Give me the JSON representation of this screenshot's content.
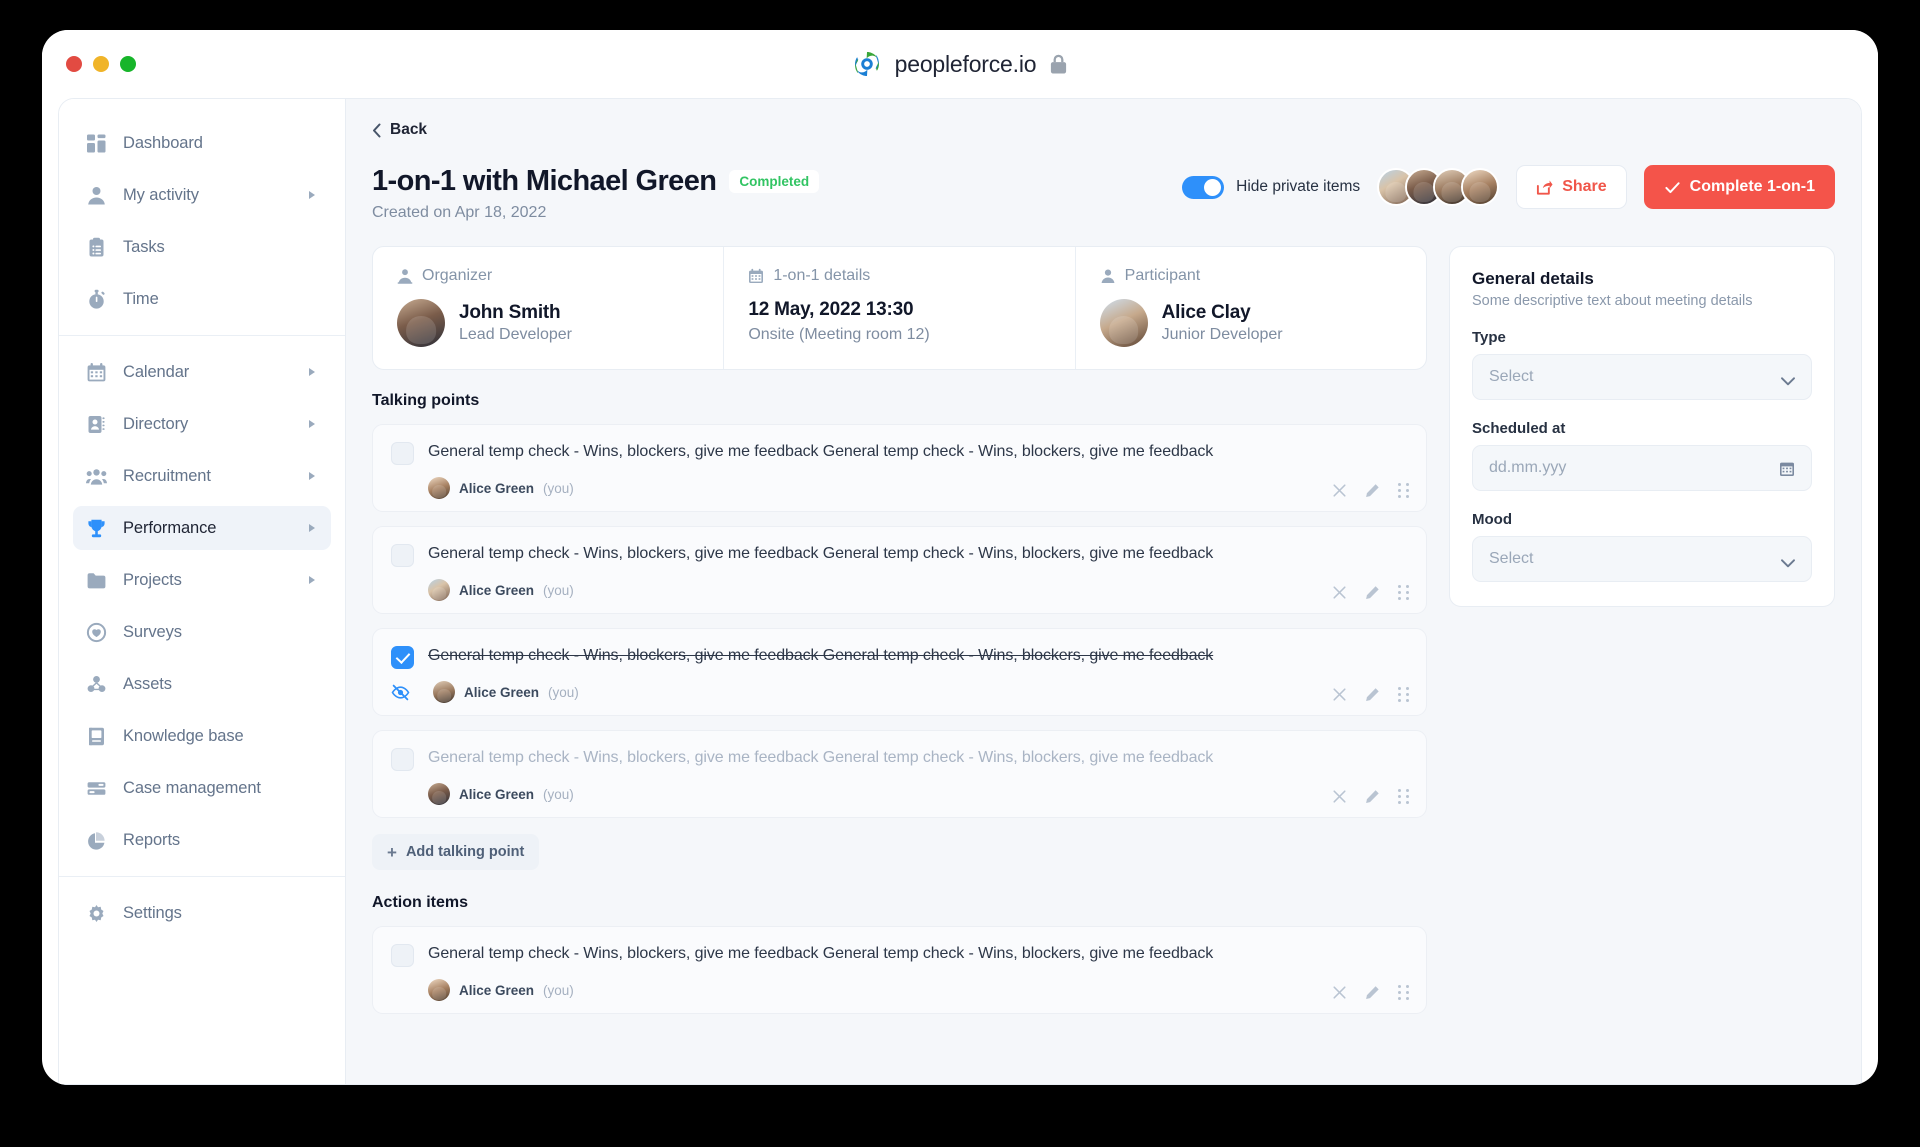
{
  "browser": {
    "url_text": "peopleforce.io",
    "lock_icon": "lock-icon",
    "logo_icon": "peopleforce-logo-icon"
  },
  "sidebar": {
    "groups": [
      {
        "items": [
          {
            "label": "Dashboard",
            "icon": "dashboard-icon",
            "has_arrow": false,
            "active": false
          },
          {
            "label": "My activity",
            "icon": "user-icon",
            "has_arrow": true,
            "active": false
          },
          {
            "label": "Tasks",
            "icon": "clipboard-icon",
            "has_arrow": false,
            "active": false
          },
          {
            "label": "Time",
            "icon": "stopwatch-icon",
            "has_arrow": false,
            "active": false
          }
        ]
      },
      {
        "items": [
          {
            "label": "Calendar",
            "icon": "calendar-icon",
            "has_arrow": true,
            "active": false
          },
          {
            "label": "Directory",
            "icon": "contact-card-icon",
            "has_arrow": true,
            "active": false
          },
          {
            "label": "Recruitment",
            "icon": "people-group-icon",
            "has_arrow": true,
            "active": false
          },
          {
            "label": "Performance",
            "icon": "trophy-icon",
            "has_arrow": true,
            "active": true
          },
          {
            "label": "Projects",
            "icon": "folder-icon",
            "has_arrow": true,
            "active": false
          },
          {
            "label": "Surveys",
            "icon": "heart-shield-icon",
            "has_arrow": false,
            "active": false
          },
          {
            "label": "Assets",
            "icon": "assets-icon",
            "has_arrow": false,
            "active": false
          },
          {
            "label": "Knowledge base",
            "icon": "book-icon",
            "has_arrow": false,
            "active": false
          },
          {
            "label": "Case management",
            "icon": "cases-icon",
            "has_arrow": false,
            "active": false
          },
          {
            "label": "Reports",
            "icon": "pie-chart-icon",
            "has_arrow": false,
            "active": false
          }
        ]
      },
      {
        "items": [
          {
            "label": "Settings",
            "icon": "gear-icon",
            "has_arrow": false,
            "active": false
          }
        ]
      }
    ]
  },
  "header": {
    "back_label": "Back",
    "title": "1-on-1 with Michael Green",
    "status_badge": "Completed",
    "subtitle": "Created on Apr 18, 2022",
    "toggle_label": "Hide private items",
    "toggle_on": true,
    "share_label": "Share",
    "complete_label": "Complete 1-on-1"
  },
  "info_cards": {
    "organizer": {
      "label": "Organizer",
      "icon": "organizer-icon",
      "name": "John Smith",
      "role": "Lead Developer"
    },
    "details": {
      "label": "1-on-1 details",
      "icon": "calendar-icon",
      "datetime": "12 May, 2022 13:30",
      "location": "Onsite (Meeting room 12)"
    },
    "participant": {
      "label": "Participant",
      "icon": "user-icon",
      "name": "Alice Clay",
      "role": "Junior Developer"
    }
  },
  "talking_points": {
    "section_title": "Talking points",
    "add_label": "Add talking point",
    "items": [
      {
        "text": "General temp check - Wins, blockers, give me feedback General temp check - Wins, blockers, give me feedback",
        "author": "Alice Green",
        "author_suffix": "(you)",
        "checked": false,
        "private": false,
        "muted": false
      },
      {
        "text": "General temp check - Wins, blockers, give me feedback General temp check - Wins, blockers, give me feedback",
        "author": "Alice Green",
        "author_suffix": "(you)",
        "checked": false,
        "private": false,
        "muted": false
      },
      {
        "text": "General temp check - Wins, blockers, give me feedback General temp check - Wins, blockers, give me feedback",
        "author": "Alice Green",
        "author_suffix": "(you)",
        "checked": true,
        "private": true,
        "muted": false
      },
      {
        "text": "General temp check - Wins, blockers, give me feedback General temp check - Wins, blockers, give me feedback",
        "author": "Alice Green",
        "author_suffix": "(you)",
        "checked": false,
        "private": false,
        "muted": true
      }
    ]
  },
  "action_items": {
    "section_title": "Action items",
    "items": [
      {
        "text": "General temp check - Wins, blockers, give me feedback General temp check - Wins, blockers, give me feedback",
        "author": "Alice Green",
        "author_suffix": "(you)",
        "checked": false,
        "private": false,
        "muted": false
      }
    ]
  },
  "general_details": {
    "title": "General details",
    "subtitle": "Some descriptive text about meeting details",
    "fields": [
      {
        "label": "Type",
        "value": "Select",
        "control": "select"
      },
      {
        "label": "Scheduled at",
        "value": "dd.mm.yyy",
        "control": "date"
      },
      {
        "label": "Mood",
        "value": "Select",
        "control": "select"
      }
    ]
  },
  "row_actions": {
    "delete": "close-icon",
    "edit": "pencil-icon",
    "drag": "drag-handle-icon"
  },
  "colors": {
    "accent_blue": "#2e90fa",
    "accent_red": "#f4544a",
    "status_green": "#32c463",
    "canvas": "#f5f7fa"
  }
}
